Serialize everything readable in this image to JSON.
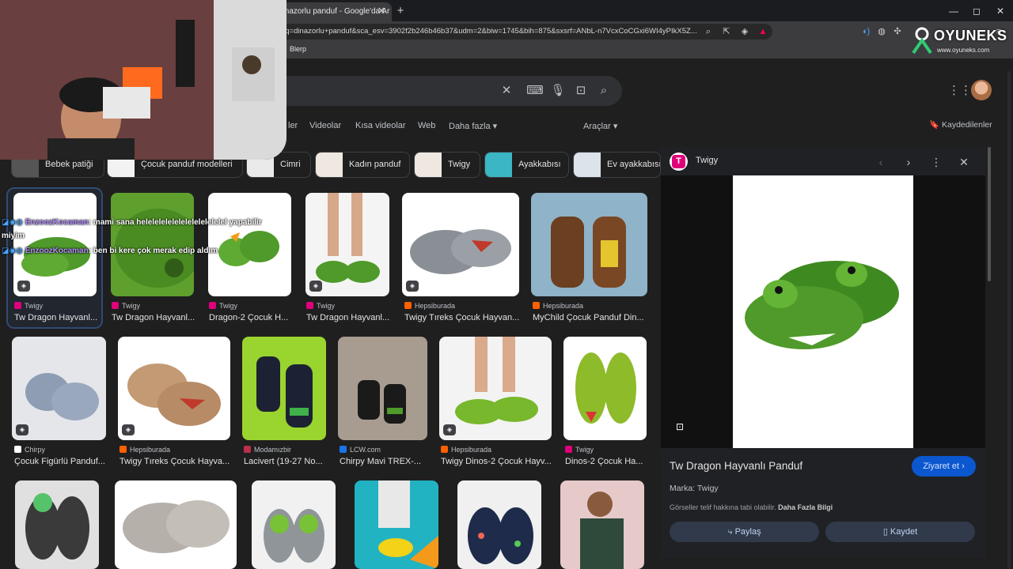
{
  "browser": {
    "tab_title": "dinazorlu panduf - Google'da Ar",
    "tab_close": "✕",
    "new_tab": "+",
    "url": "2q=dinazorlu+panduf&sca_esv=3902f2b246b46b37&udm=2&biw=1745&bih=875&sxsrf=ANbL-n7VcxCoCGxi6WI4yPIkX5Z...",
    "bookmark": "Blerp",
    "window_controls": [
      "—",
      "◻",
      "✕"
    ]
  },
  "google": {
    "nav_tabs": [
      "ler",
      "Videolar",
      "Kısa videolar",
      "Web",
      "Daha fazla ▾",
      "Araçlar ▾"
    ],
    "saved_label": "Kaydedilenler",
    "chips": [
      "Bebek patiği",
      "Çocuk panduf modelleri",
      "Cimri",
      "Kadın panduf",
      "Twigy",
      "Ayakkabısı",
      "Ev ayakkabısı"
    ]
  },
  "results": {
    "row1": [
      {
        "source": "Twigy",
        "title": "Tw Dragon Hayvanl..."
      },
      {
        "source": "Twigy",
        "title": "Tw Dragon Hayvanl..."
      },
      {
        "source": "Twigy",
        "title": "Dragon-2 Çocuk H..."
      },
      {
        "source": "Twigy",
        "title": "Tw Dragon Hayvanl..."
      },
      {
        "source": "Hepsiburada",
        "title": "Twigy Tıreks Çocuk Hayvan..."
      },
      {
        "source": "Hepsiburada",
        "title": "MyChild Çocuk Panduf Din..."
      }
    ],
    "row2": [
      {
        "source": "Chirpy",
        "title": "Çocuk Figürlü Panduf..."
      },
      {
        "source": "Hepsiburada",
        "title": "Twigy Tıreks Çocuk Hayva..."
      },
      {
        "source": "Modamızbir",
        "title": "Lacivert (19-27 No..."
      },
      {
        "source": "LCW.com",
        "title": "Chirpy Mavi TREX-..."
      },
      {
        "source": "Hepsiburada",
        "title": "Twigy Dinos-2 Çocuk Hayv..."
      },
      {
        "source": "Twigy",
        "title": "Dinos-2 Çocuk Ha..."
      }
    ]
  },
  "panel": {
    "source": "Twigy",
    "source_letter": "T",
    "title": "Tw Dragon Hayvanlı Panduf",
    "visit_label": "Ziyaret et ›",
    "brand": "Marka: Twigy",
    "copyright": "Görseller telif hakkına tabi olabilir.",
    "more_info": "Daha Fazla Bilgi",
    "share_label": "Paylaş",
    "save_label": "Kaydet"
  },
  "overlay": {
    "logo_text": "OYUNEKS",
    "logo_sub": "www.oyuneks.com",
    "chat": [
      {
        "user": "EnzoozKocaman",
        "text": ": mami sana helelelelelelelelelelelelel yapabilir"
      },
      {
        "user": "",
        "text": "miyim"
      },
      {
        "user": "EnzoozKocaman",
        "text": ": ben bi kere çok merak edip aldım"
      }
    ]
  },
  "colors": {
    "twigy": "#e0007a",
    "hepsiburada": "#ff6000",
    "accent_blue": "#0b57d0",
    "dino_green": "#4f9a2a"
  }
}
